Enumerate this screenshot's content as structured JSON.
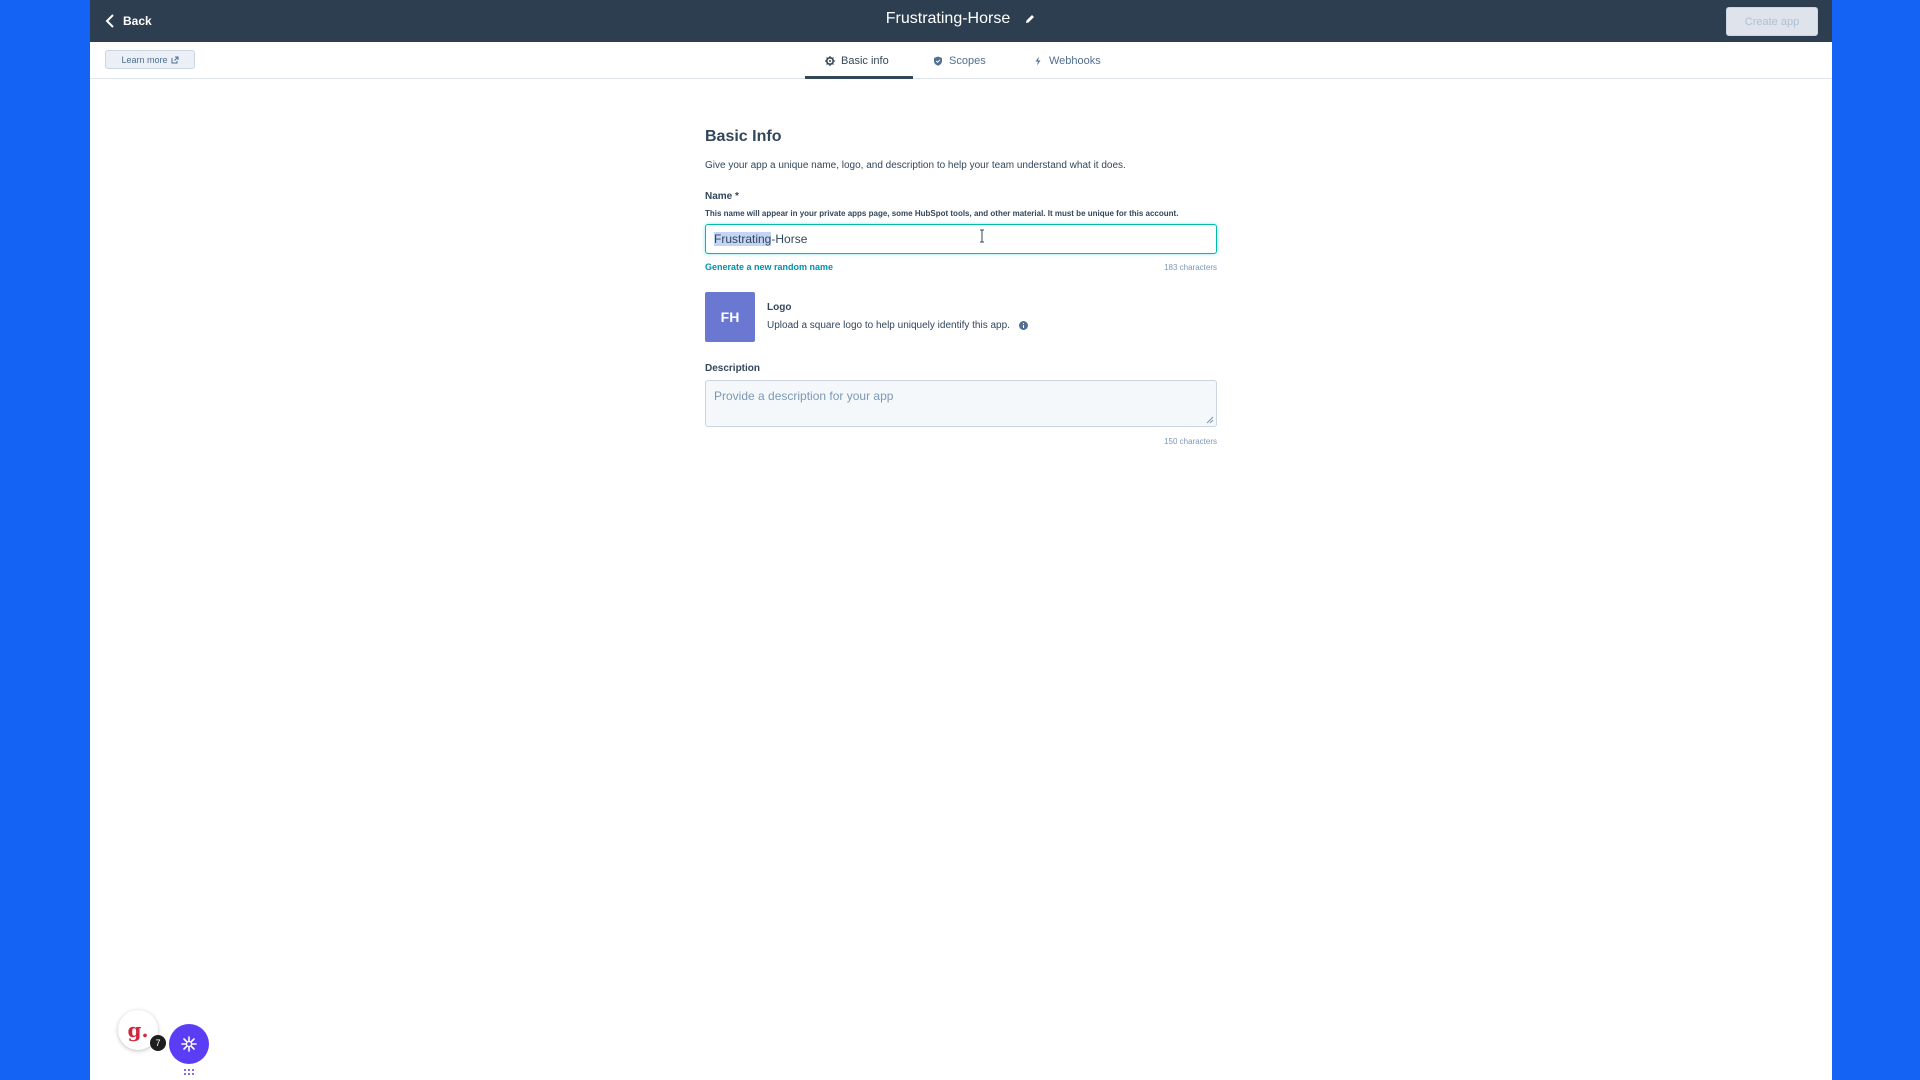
{
  "header": {
    "back_label": "Back",
    "title": "Frustrating-Horse",
    "create_button": "Create app"
  },
  "subbar": {
    "learn_more": "Learn more",
    "tabs": [
      {
        "label": "Basic info",
        "icon": "gear-icon",
        "active": true
      },
      {
        "label": "Scopes",
        "icon": "shield-icon",
        "active": false
      },
      {
        "label": "Webhooks",
        "icon": "bolt-icon",
        "active": false
      }
    ]
  },
  "form": {
    "heading": "Basic Info",
    "intro": "Give your app a unique name, logo, and description to help your team understand what it does.",
    "name_label": "Name *",
    "name_help": "This name will appear in your private apps page, some HubSpot tools, and other material. It must be unique for this account.",
    "name_value_selected": "Frustrating",
    "name_value_rest": "-Horse",
    "generate_link": "Generate a new random name",
    "name_counter": "183 characters",
    "logo_initials": "FH",
    "logo_label": "Logo",
    "logo_help": "Upload a square logo to help uniquely identify this app.",
    "description_label": "Description",
    "description_placeholder": "Provide a description for your app",
    "description_counter": "150 characters"
  },
  "widgets": {
    "g_letter": "g.",
    "g_badge": "7"
  },
  "colors": {
    "background": "#1463f5",
    "topbar": "#2d3e50",
    "logo": "#6a78d1",
    "link": "#0091ae",
    "focus": "#00bda5"
  }
}
